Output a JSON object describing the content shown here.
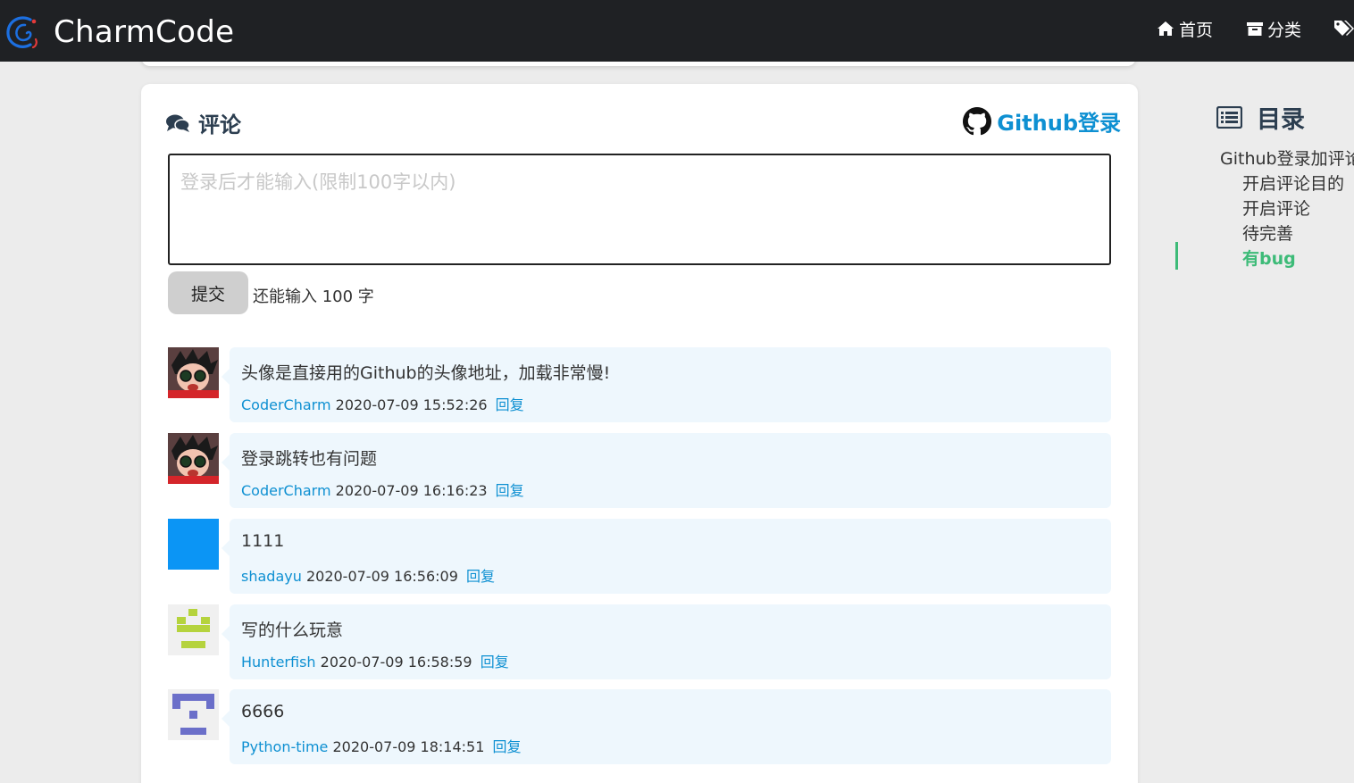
{
  "navbar": {
    "brand": "CharmCode",
    "items": [
      {
        "label": "首页",
        "icon": "home-icon"
      },
      {
        "label": "分类",
        "icon": "archive-icon"
      },
      {
        "label": "",
        "icon": "tags-icon"
      }
    ]
  },
  "comments_section": {
    "title": "评论",
    "github_login": "Github登录",
    "input_placeholder": "登录后才能输入(限制100字以内)",
    "submit_label": "提交",
    "remaining_text": "还能输入 100 字",
    "list": [
      {
        "text": "头像是直接用的Github的头像地址，加载非常慢!",
        "user": "CoderCharm",
        "time": "2020-07-09 15:52:26",
        "reply": "回复",
        "avatar": "cartoon-avatar"
      },
      {
        "text": "登录跳转也有问题",
        "user": "CoderCharm",
        "time": "2020-07-09 16:16:23",
        "reply": "回复",
        "avatar": "cartoon-avatar"
      },
      {
        "text": "1111",
        "user": "shadayu",
        "time": "2020-07-09 16:56:09",
        "reply": "回复",
        "avatar": "blue-square-avatar"
      },
      {
        "text": "写的什么玩意",
        "user": "Hunterfish",
        "time": "2020-07-09 16:58:59",
        "reply": "回复",
        "avatar": "green-identicon-avatar"
      },
      {
        "text": "6666",
        "user": "Python-time",
        "time": "2020-07-09 18:14:51",
        "reply": "回复",
        "avatar": "purple-identicon-avatar"
      }
    ]
  },
  "toc": {
    "title": "目录",
    "items": [
      {
        "label": "Github登录加评论",
        "level": 1,
        "active": false
      },
      {
        "label": "开启评论目的",
        "level": 2,
        "active": false
      },
      {
        "label": "开启评论",
        "level": 2,
        "active": false
      },
      {
        "label": "待完善",
        "level": 2,
        "active": false
      },
      {
        "label": "有bug",
        "level": 2,
        "active": true
      }
    ]
  },
  "colors": {
    "navbar_bg": "#1f2124",
    "link": "#0e90d2",
    "toc_active": "#3dbb78",
    "bubble_bg": "#eef7fd"
  }
}
